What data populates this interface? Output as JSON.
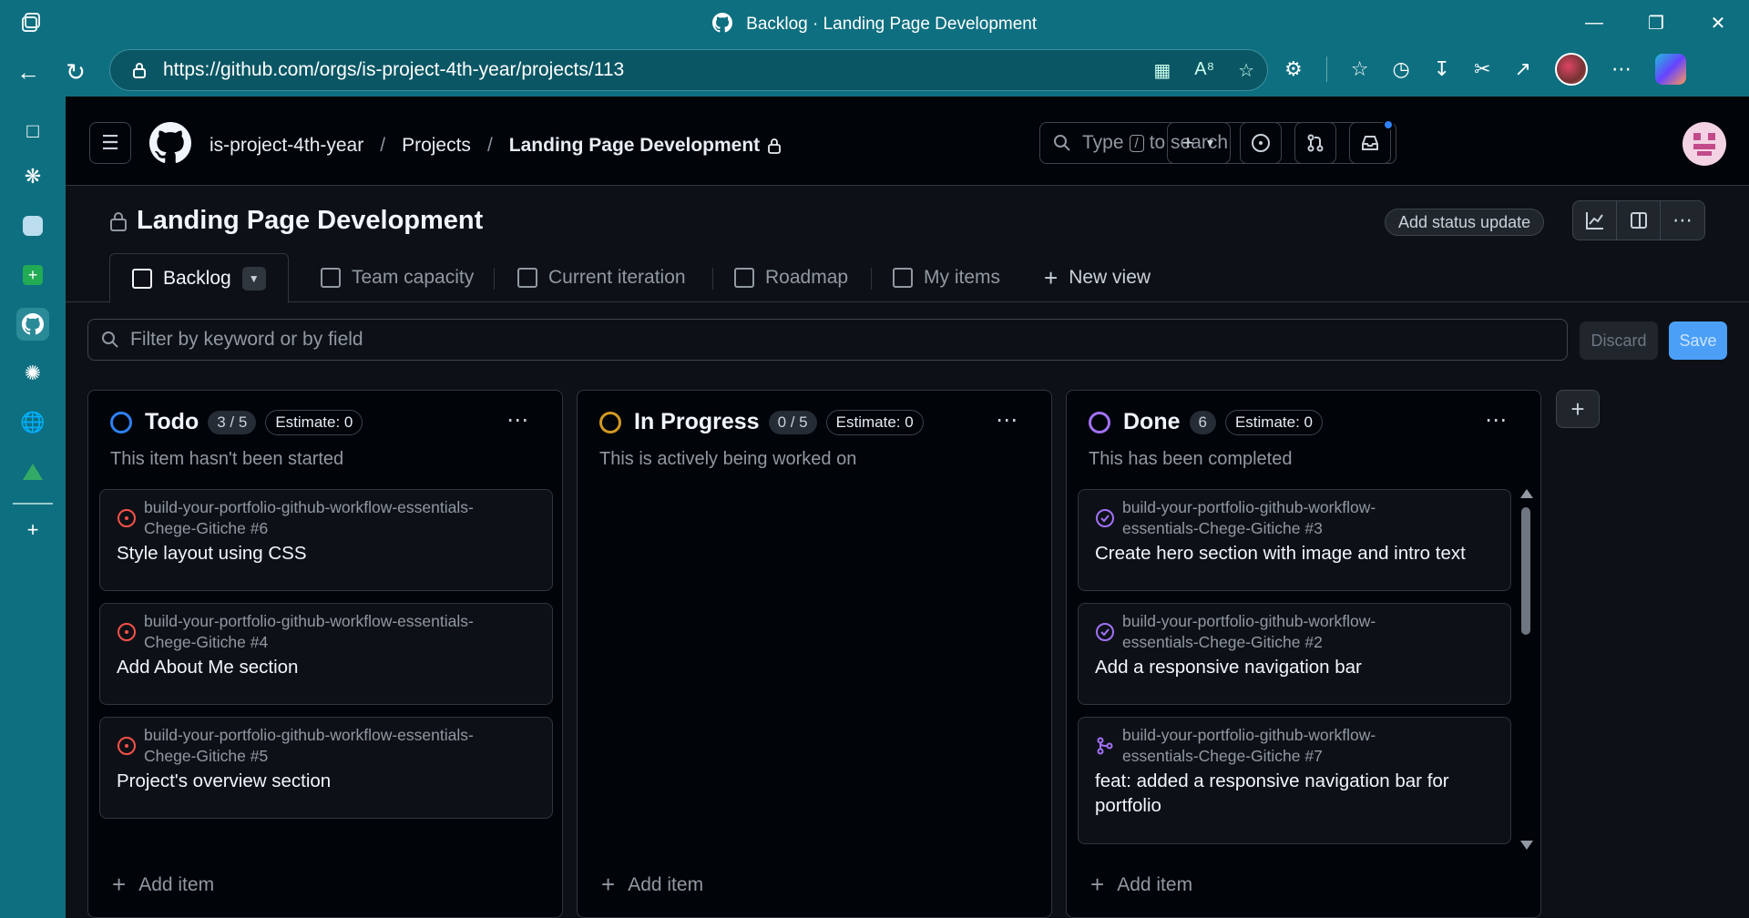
{
  "browser": {
    "window_title": "Backlog · Landing Page Development",
    "url": "https://github.com/orgs/is-project-4th-year/projects/113"
  },
  "header": {
    "breadcrumbs": [
      "is-project-4th-year",
      "Projects",
      "Landing Page Development"
    ],
    "search_prefix": "Type",
    "search_key": "/",
    "search_suffix": "to search"
  },
  "project": {
    "title": "Landing Page Development",
    "status_update_label": "Add status update"
  },
  "tabs": [
    {
      "label": "Backlog",
      "active": true
    },
    {
      "label": "Team capacity"
    },
    {
      "label": "Current iteration"
    },
    {
      "label": "Roadmap"
    },
    {
      "label": "My items"
    },
    {
      "label": "New view"
    }
  ],
  "filter": {
    "placeholder": "Filter by keyword or by field",
    "discard_label": "Discard",
    "save_label": "Save"
  },
  "columns": [
    {
      "name": "Todo",
      "count": "3 / 5",
      "estimate": "Estimate: 0",
      "description": "This item hasn't been started",
      "color": "#2f81f7",
      "add_label": "Add item",
      "cards": [
        {
          "repo_line1": "build-your-portfolio-github-workflow-essentials-",
          "repo_line2": "Chege-Gitiche #6",
          "title": "Style layout using CSS",
          "state": "open-issue"
        },
        {
          "repo_line1": "build-your-portfolio-github-workflow-essentials-",
          "repo_line2": "Chege-Gitiche #4",
          "title": "Add About Me section",
          "state": "open-issue"
        },
        {
          "repo_line1": "build-your-portfolio-github-workflow-essentials-",
          "repo_line2": "Chege-Gitiche #5",
          "title": "Project's overview section",
          "state": "open-issue"
        }
      ]
    },
    {
      "name": "In Progress",
      "count": "0 / 5",
      "estimate": "Estimate: 0",
      "description": "This is actively being worked on",
      "color": "#d29922",
      "add_label": "Add item",
      "cards": []
    },
    {
      "name": "Done",
      "count": "6",
      "estimate": "Estimate: 0",
      "description": "This has been completed",
      "color": "#a371f7",
      "add_label": "Add item",
      "cards": [
        {
          "repo_line1": "build-your-portfolio-github-workflow-",
          "repo_line2": "essentials-Chege-Gitiche #3",
          "title": "Create hero section with image and intro text",
          "state": "closed-issue"
        },
        {
          "repo_line1": "build-your-portfolio-github-workflow-",
          "repo_line2": "essentials-Chege-Gitiche #2",
          "title": "Add a responsive navigation bar",
          "state": "closed-issue"
        },
        {
          "repo_line1": "build-your-portfolio-github-workflow-",
          "repo_line2": "essentials-Chege-Gitiche #7",
          "title_line1": "feat: added a responsive navigation bar for",
          "title_line2": "portfolio",
          "state": "merged-pr"
        }
      ]
    }
  ],
  "colors": {
    "open_issue": "#f85149",
    "closed_issue": "#a371f7",
    "merged_pr": "#a371f7",
    "accent": "#4b9ff7",
    "browser_chrome": "#0e6f80"
  }
}
